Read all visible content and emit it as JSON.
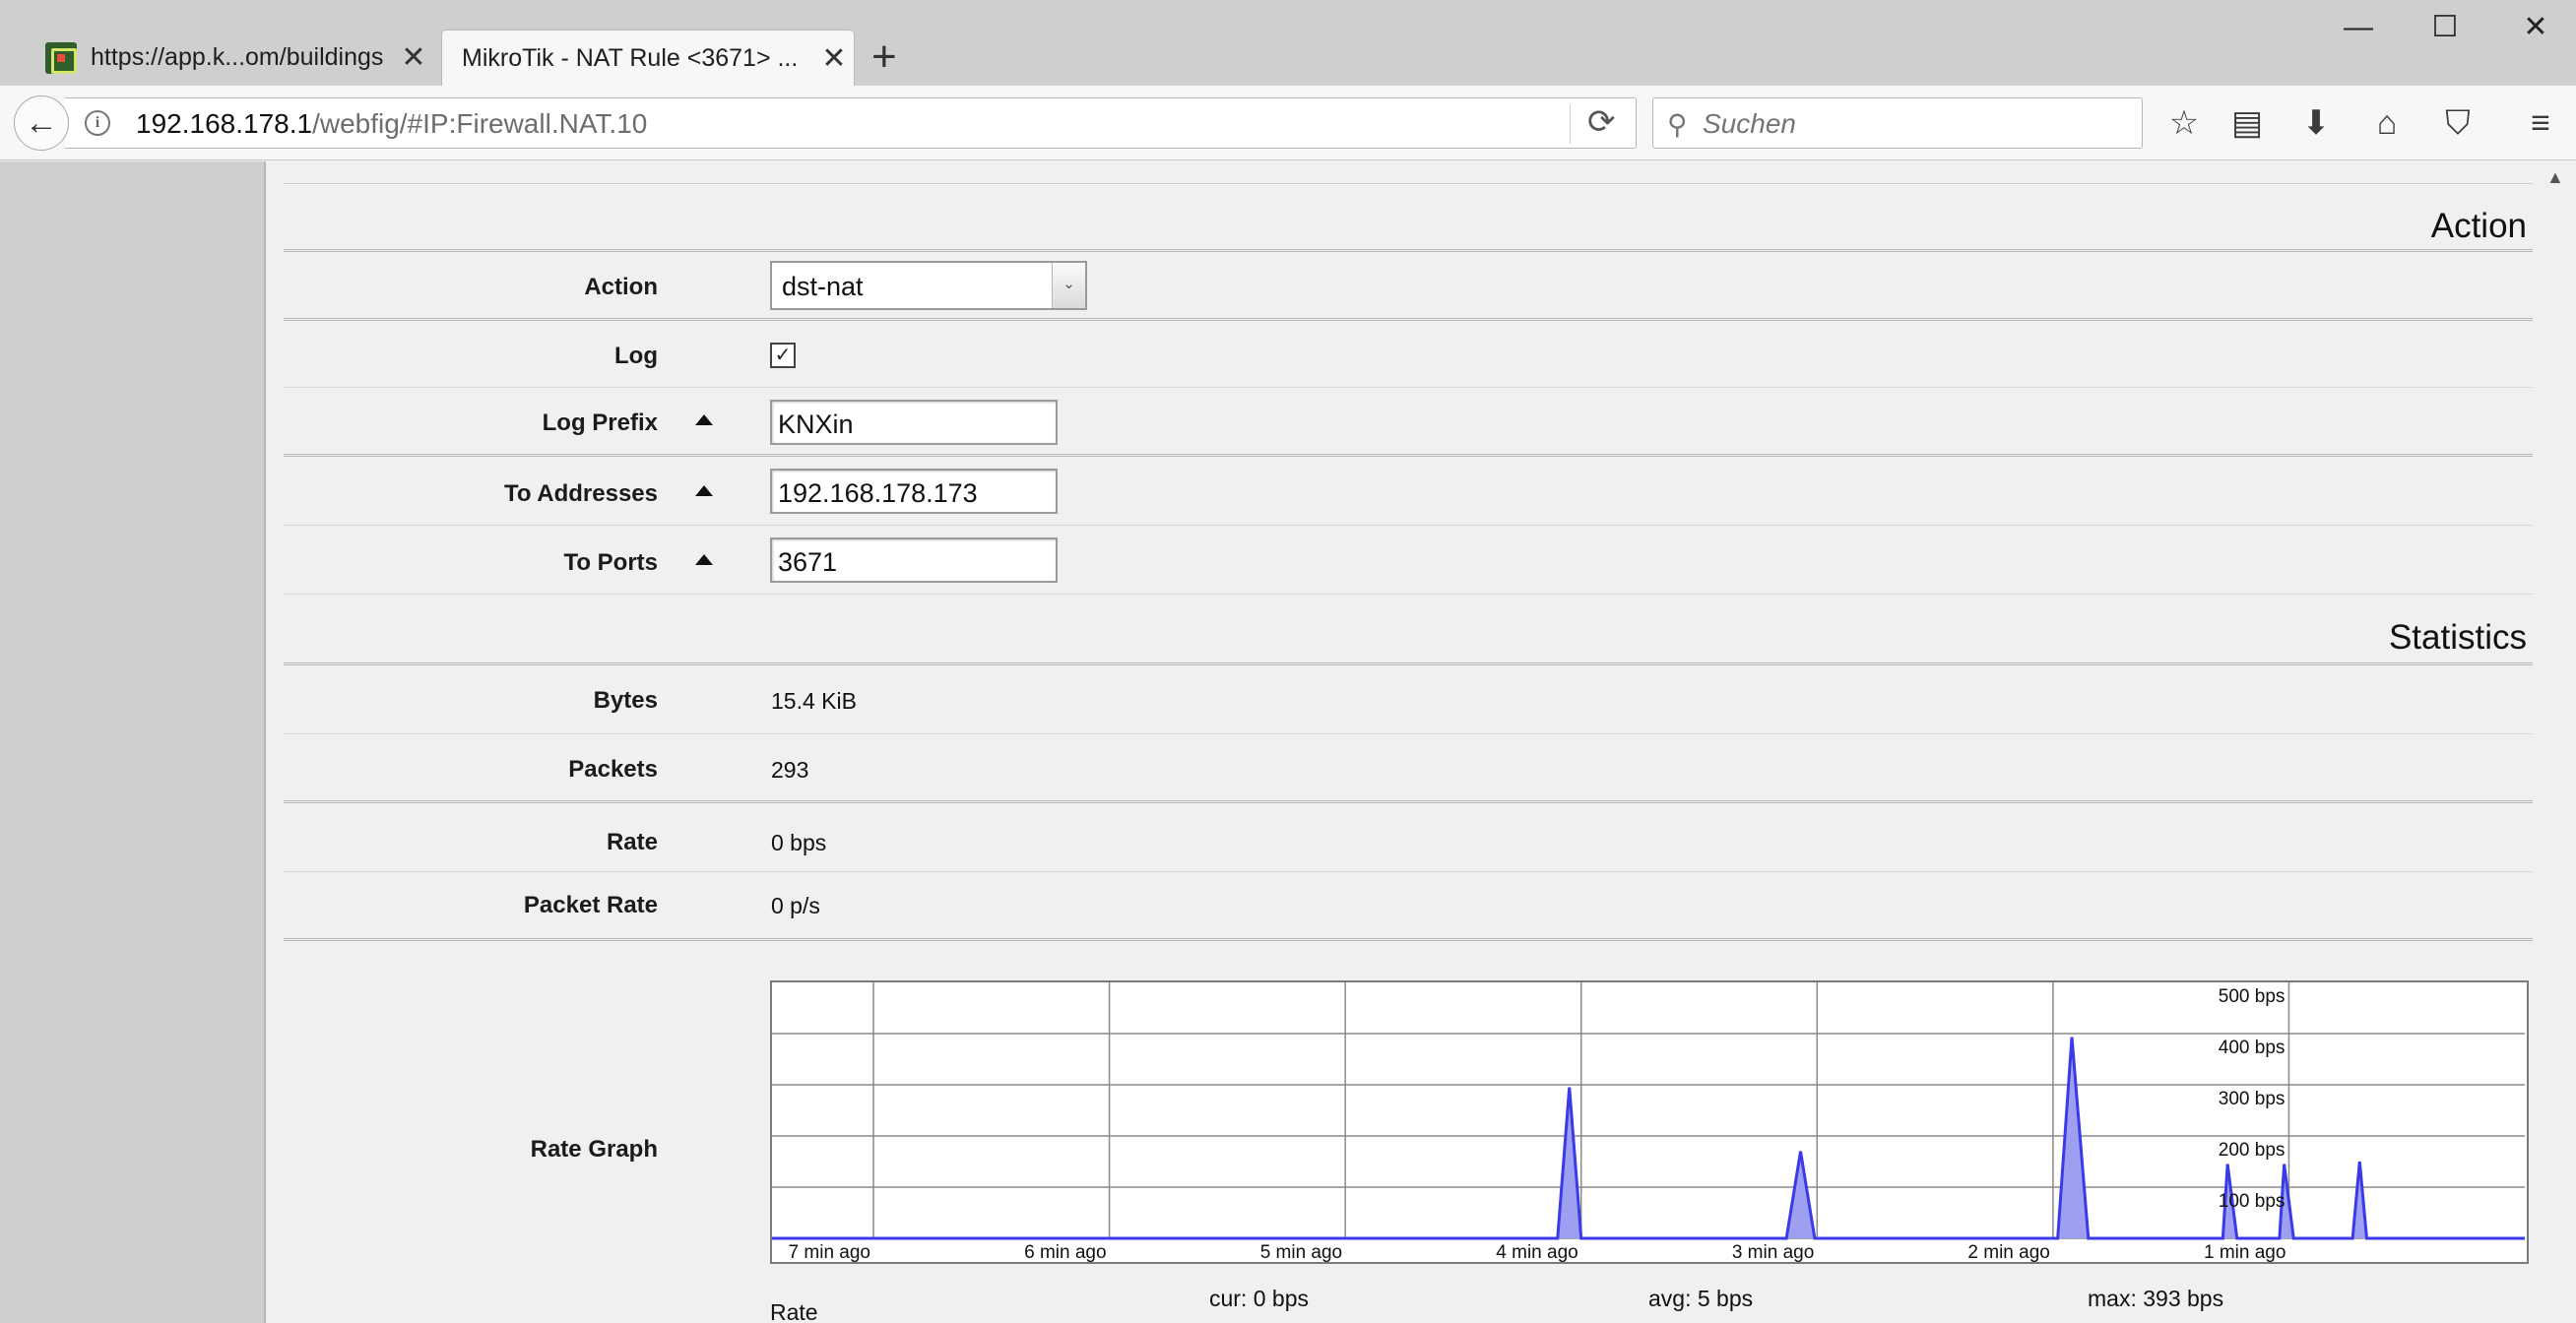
{
  "browser": {
    "tabs": [
      {
        "title": "https://app.k...om/buildings",
        "active": false
      },
      {
        "title": "MikroTik - NAT Rule <3671> ...",
        "active": true
      }
    ],
    "url_host": "192.168.178.1",
    "url_path": "/webfig/#IP:Firewall.NAT.10",
    "search_placeholder": "Suchen"
  },
  "sections": {
    "action": "Action",
    "statistics": "Statistics"
  },
  "fields": {
    "action": {
      "label": "Action",
      "value": "dst-nat"
    },
    "log": {
      "label": "Log",
      "checked": true
    },
    "log_prefix": {
      "label": "Log Prefix",
      "value": "KNXin"
    },
    "to_addresses": {
      "label": "To Addresses",
      "value": "192.168.178.173"
    },
    "to_ports": {
      "label": "To Ports",
      "value": "3671"
    }
  },
  "stats": {
    "bytes": {
      "label": "Bytes",
      "value": "15.4 KiB"
    },
    "packets": {
      "label": "Packets",
      "value": "293"
    },
    "rate": {
      "label": "Rate",
      "value": "0 bps"
    },
    "packet_rate": {
      "label": "Packet Rate",
      "value": "0 p/s"
    },
    "rate_graph": {
      "label": "Rate Graph"
    }
  },
  "graph_footer": {
    "legend": "Rate",
    "cur": "cur: 0 bps",
    "avg": "avg: 5 bps",
    "max": "max: 393 bps"
  },
  "colors": {
    "graph_fill": "#9f9ff2",
    "graph_line": "#3a3ae8"
  },
  "chart_data": {
    "type": "area",
    "x_unit": "minutes ago",
    "xlim": [
      7.43,
      0
    ],
    "ylim": [
      0,
      500
    ],
    "y_ticks": [
      100,
      200,
      300,
      400,
      500
    ],
    "y_tick_labels": [
      "100 bps",
      "200 bps",
      "300 bps",
      "400 bps",
      "500 bps"
    ],
    "x_ticks": [
      7,
      6,
      5,
      4,
      3,
      2,
      1
    ],
    "x_tick_labels": [
      "7 min ago",
      "6 min ago",
      "5 min ago",
      "4 min ago",
      "3 min ago",
      "2 min ago",
      "1 min ago"
    ],
    "grid": true,
    "series": [
      {
        "x": [
          7.43,
          4.1,
          4.05,
          4.0,
          3.13,
          3.07,
          3.01,
          1.98,
          1.92,
          1.85,
          1.28,
          1.26,
          1.22,
          1.04,
          1.02,
          0.98,
          0.73,
          0.7,
          0.67,
          0
        ],
        "y": [
          0,
          0,
          295,
          0,
          0,
          170,
          0,
          0,
          393,
          0,
          0,
          145,
          0,
          0,
          145,
          0,
          0,
          150,
          0,
          0
        ]
      }
    ]
  }
}
